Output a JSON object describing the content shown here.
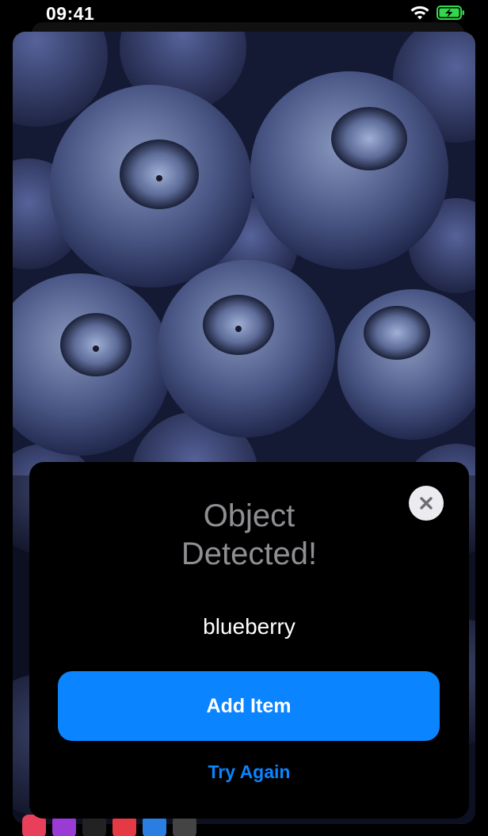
{
  "status_bar": {
    "time": "09:41",
    "wifi_icon": "wifi-icon",
    "battery_icon": "battery-charging-icon"
  },
  "camera": {
    "subject_icon": "blueberries-photo"
  },
  "modal": {
    "title": "Object\nDetected!",
    "close_icon": "close-icon",
    "detected_object": "blueberry",
    "primary_button_label": "Add Item",
    "secondary_button_label": "Try Again"
  },
  "colors": {
    "accent": "#0a84ff",
    "modal_background": "#000000",
    "title_gray": "#8e8e93",
    "battery_green": "#32d74b"
  }
}
